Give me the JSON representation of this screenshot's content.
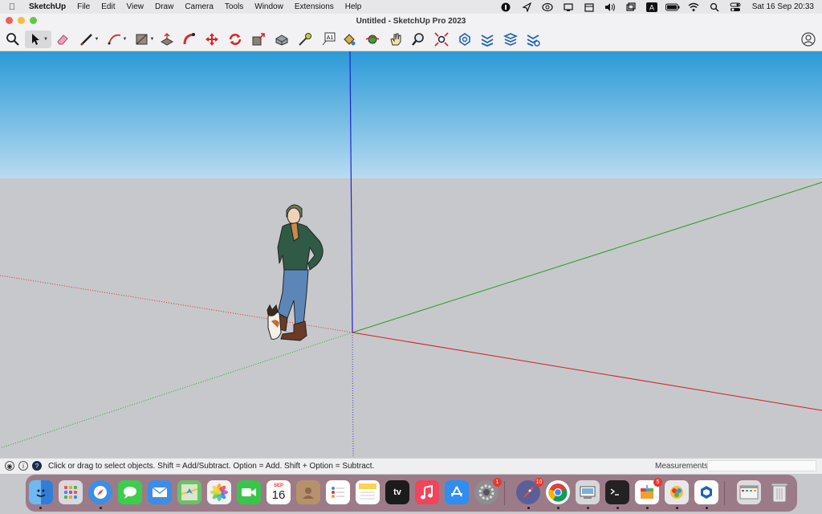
{
  "menubar": {
    "app_name": "SketchUp",
    "items": [
      "File",
      "Edit",
      "View",
      "Draw",
      "Camera",
      "Tools",
      "Window",
      "Extensions",
      "Help"
    ],
    "status_icons": [
      "1password-icon",
      "location-icon",
      "creative-cloud-icon",
      "display-icon",
      "calendar-icon",
      "volume-icon",
      "window-icon",
      "input-source-icon",
      "battery-icon",
      "wifi-icon",
      "spotlight-icon",
      "control-center-icon"
    ],
    "input_source": "A",
    "clock": "Sat 16 Sep  20:33"
  },
  "window": {
    "title": "Untitled - SketchUp Pro 2023",
    "traffic_colors": [
      "#ee5f57",
      "#f6bd3b",
      "#5fc84a"
    ]
  },
  "toolbar": {
    "tools": [
      "search-tool",
      "select-tool",
      "eraser-tool",
      "line-tool",
      "arc-tool",
      "shape-tool",
      "push-pull-tool",
      "follow-me-tool",
      "move-tool",
      "rotate-tool",
      "scale-tool",
      "offset-tool",
      "tape-measure-tool",
      "text-tool",
      "paint-bucket-tool",
      "orbit-tool",
      "pan-tool",
      "zoom-tool",
      "zoom-extents-tool",
      "warehouse-tool",
      "extension-warehouse-tool",
      "layout-tool",
      "extension-manager-tool"
    ]
  },
  "viewport": {
    "sky_top": "#2b9ad8",
    "sky_bottom": "#b8dbf0",
    "ground": "#c7c8cc",
    "axis_colors": {
      "x": "#d02020",
      "y": "#20a020",
      "z": "#2020d0"
    }
  },
  "statusbar": {
    "hint": "Click or drag to select objects. Shift = Add/Subtract. Option = Add. Shift + Option = Subtract.",
    "measurements_label": "Measurements",
    "measurements_value": ""
  },
  "dock": {
    "apps": [
      {
        "name": "finder",
        "color": "#3a8ee8"
      },
      {
        "name": "launchpad",
        "color": "#d9d9de"
      },
      {
        "name": "safari",
        "color": "#3b8fe6"
      },
      {
        "name": "messages",
        "color": "#3ccd4c"
      },
      {
        "name": "mail",
        "color": "#3d8de6"
      },
      {
        "name": "maps",
        "color": "#6ac16a"
      },
      {
        "name": "photos",
        "color": "#f2f2f2"
      },
      {
        "name": "facetime",
        "color": "#38c64a"
      },
      {
        "name": "calendar",
        "color": "#ffffff"
      },
      {
        "name": "contacts",
        "color": "#b7916c"
      },
      {
        "name": "reminders",
        "color": "#ffffff"
      },
      {
        "name": "notes",
        "color": "#f7d54d"
      },
      {
        "name": "apple-tv",
        "color": "#1b1b1b"
      },
      {
        "name": "music",
        "color": "#f2445a"
      },
      {
        "name": "app-store",
        "color": "#2f8ef0"
      },
      {
        "name": "system-settings",
        "color": "#8d8d92"
      },
      {
        "name": "rocket-typist",
        "color": "#5a5f9a"
      },
      {
        "name": "chrome",
        "color": "#ffffff"
      },
      {
        "name": "preview",
        "color": "#d7d7d9"
      },
      {
        "name": "terminal",
        "color": "#222222"
      },
      {
        "name": "app-installer",
        "color": "#ffffff"
      },
      {
        "name": "pixelmator",
        "color": "#e8e8ea"
      },
      {
        "name": "sketchup",
        "color": "#ffffff"
      },
      {
        "name": "screenshot-thumb",
        "color": "#dcdcdc"
      },
      {
        "name": "trash",
        "color": "#e5e5e7"
      }
    ],
    "calendar_month": "SEP",
    "calendar_day": "16",
    "tv_label": "tv",
    "badges": {
      "system-settings": "1",
      "rocket-typist": "10",
      "app-installer": "5"
    }
  }
}
